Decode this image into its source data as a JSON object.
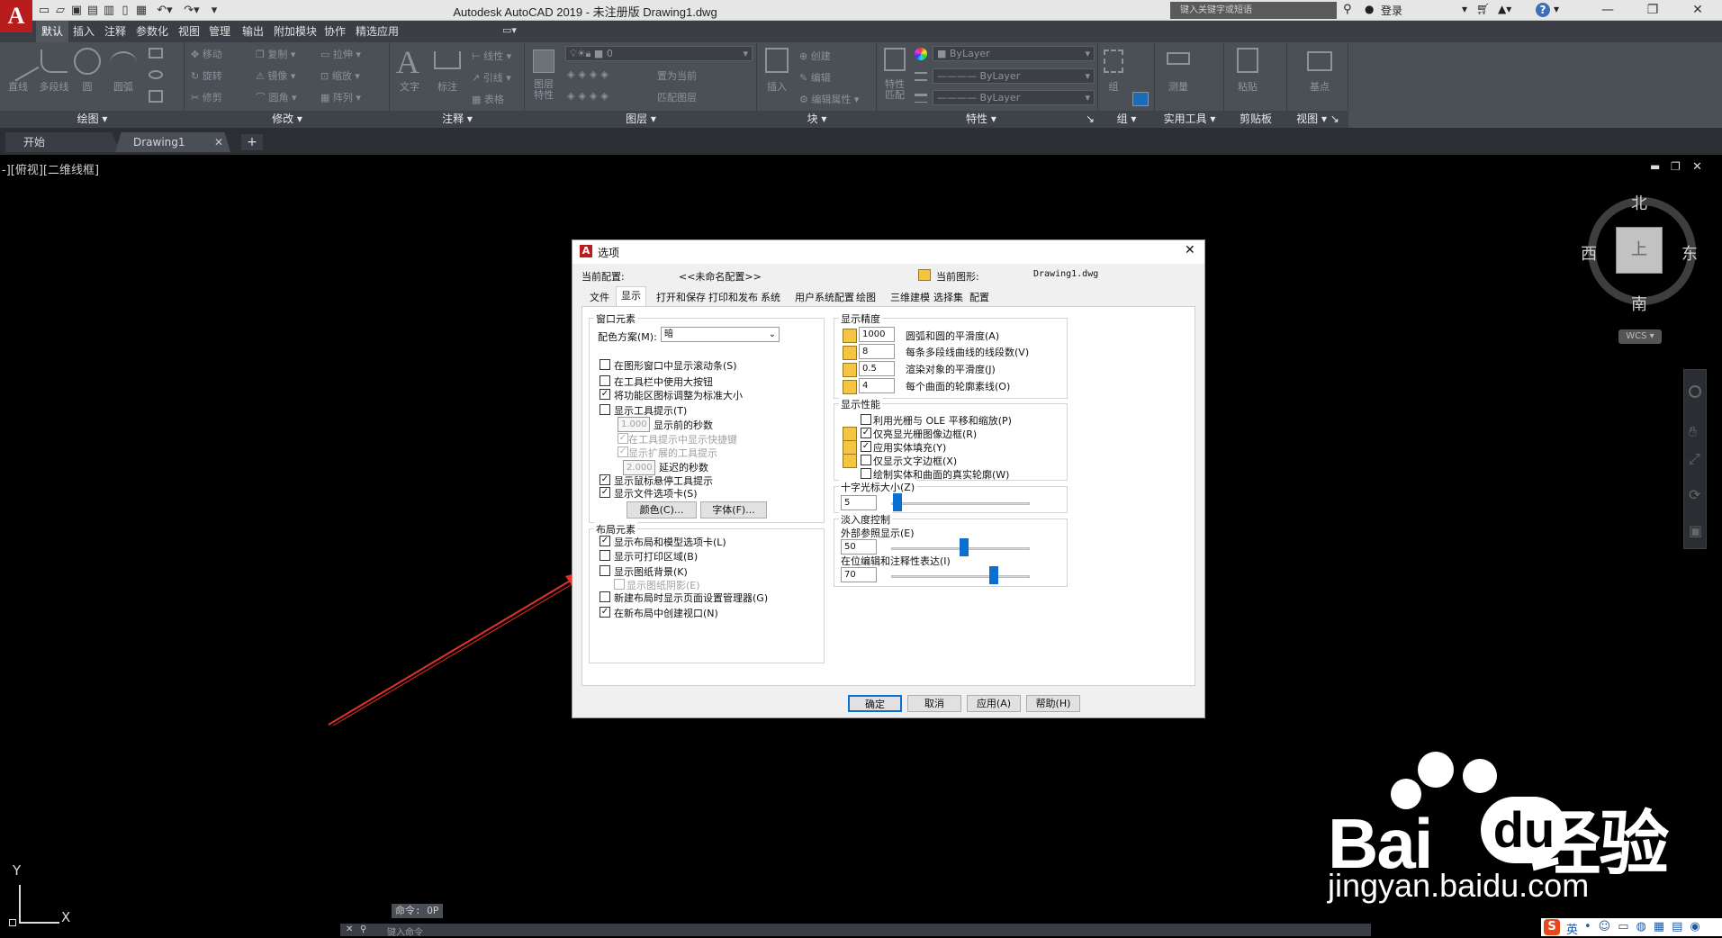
{
  "app": {
    "logo": "A",
    "title": "Autodesk AutoCAD 2019 - 未注册版    Drawing1.dwg",
    "search_placeholder": "键入关键字或短语",
    "login": "登录",
    "help": "?"
  },
  "ribbon_tabs": [
    "默认",
    "插入",
    "注释",
    "参数化",
    "视图",
    "管理",
    "输出",
    "附加模块",
    "协作",
    "精选应用"
  ],
  "ribbon": {
    "draw": {
      "label": "绘图",
      "tools": [
        "直线",
        "多段线",
        "圆",
        "圆弧"
      ]
    },
    "modify": {
      "label": "修改",
      "tools": [
        "移动",
        "旋转",
        "修剪",
        "复制",
        "镜像",
        "圆角",
        "拉伸",
        "缩放",
        "阵列"
      ]
    },
    "annotation": {
      "label": "注释",
      "tools": [
        "文字",
        "标注",
        "线性",
        "引线",
        "表格"
      ]
    },
    "layers": {
      "label": "图层",
      "tools": [
        "图层特性",
        "置为当前",
        "匹配图层"
      ],
      "current_layer": "0"
    },
    "block": {
      "label": "块",
      "tools": [
        "插入",
        "创建",
        "编辑",
        "编辑属性"
      ]
    },
    "properties": {
      "label": "特性",
      "tools": [
        "特性匹配"
      ],
      "color": "ByLayer",
      "linetype": "ByLayer",
      "lineweight": "ByLayer"
    },
    "groups": {
      "label": "组",
      "tools": [
        "组"
      ]
    },
    "utilities": {
      "label": "实用工具",
      "tools": [
        "测量"
      ]
    },
    "clipboard": {
      "label": "剪贴板",
      "tools": [
        "粘贴"
      ]
    },
    "view": {
      "label": "视图",
      "tools": [
        "基点"
      ]
    }
  },
  "file_tabs": [
    "开始",
    "Drawing1"
  ],
  "viewport_label": "-][俯视][二维线框]",
  "viewcube": {
    "north": "北",
    "south": "南",
    "east": "东",
    "west": "西",
    "top": "上",
    "wcs": "WCS"
  },
  "ucs": {
    "y": "Y",
    "x": "X"
  },
  "command": {
    "history": "命令: OP",
    "placeholder": "键入命令"
  },
  "dialog": {
    "title": "选项",
    "current_profile_label": "当前配置:",
    "current_profile": "<<未命名配置>>",
    "current_drawing_label": "当前图形:",
    "current_drawing": "Drawing1.dwg",
    "tabs": [
      "文件",
      "显示",
      "打开和保存",
      "打印和发布",
      "系统",
      "用户系统配置",
      "绘图",
      "三维建模",
      "选择集",
      "配置"
    ],
    "window_elements": {
      "title": "窗口元素",
      "color_scheme_label": "配色方案(M):",
      "color_scheme": "暗",
      "opt_scrollbars": "在图形窗口中显示滚动条(S)",
      "opt_large_buttons": "在工具栏中使用大按钮",
      "opt_resize_icons": "将功能区图标调整为标准大小",
      "opt_tooltips": "显示工具提示(T)",
      "seconds_before": "1.000",
      "seconds_before_label": "显示前的秒数",
      "opt_shortcut_keys": "在工具提示中显示快捷键",
      "opt_extended_tips": "显示扩展的工具提示",
      "delay_seconds": "2.000",
      "delay_seconds_label": "延迟的秒数",
      "opt_rollover": "显示鼠标悬停工具提示",
      "opt_file_tabs": "显示文件选项卡(S)",
      "colors_button": "颜色(C)...",
      "fonts_button": "字体(F)..."
    },
    "layout_elements": {
      "title": "布局元素",
      "opt_layout_tabs": "显示布局和模型选项卡(L)",
      "opt_printable_area": "显示可打印区域(B)",
      "opt_paper_bg": "显示图纸背景(K)",
      "opt_paper_shadow": "显示图纸阴影(E)",
      "opt_page_setup": "新建布局时显示页面设置管理器(G)",
      "opt_create_viewport": "在新布局中创建视口(N)"
    },
    "display_resolution": {
      "title": "显示精度",
      "arc_smooth": "1000",
      "arc_smooth_label": "圆弧和圆的平滑度(A)",
      "pline_segments": "8",
      "pline_segments_label": "每条多段线曲线的线段数(V)",
      "render_smooth": "0.5",
      "render_smooth_label": "渲染对象的平滑度(J)",
      "contour_lines": "4",
      "contour_lines_label": "每个曲面的轮廓素线(O)"
    },
    "display_performance": {
      "title": "显示性能",
      "opt_pan_zoom": "利用光栅与 OLE 平移和缩放(P)",
      "opt_highlight_raster": "仅亮显光栅图像边框(R)",
      "opt_solid_fill": "应用实体填充(Y)",
      "opt_text_frame": "仅显示文字边框(X)",
      "opt_silhouettes": "绘制实体和曲面的真实轮廓(W)"
    },
    "crosshair": {
      "title": "十字光标大小(Z)",
      "value": "5",
      "level": 5
    },
    "fade": {
      "title": "淡入度控制",
      "xref_label": "外部参照显示(E)",
      "xref_value": "50",
      "xref_level": 50,
      "inplace_label": "在位编辑和注释性表达(I)",
      "inplace_value": "70",
      "inplace_level": 70
    },
    "buttons": {
      "ok": "确定",
      "cancel": "取消",
      "apply": "应用(A)",
      "help": "帮助(H)"
    }
  },
  "watermark": {
    "brand": "Bai",
    "brand2": "du",
    "cn": "经验",
    "url": "jingyan.baidu.com"
  },
  "taskbar": {
    "ime": "英"
  },
  "colors": {
    "accent": "#0a6fd1",
    "arrow": "#e0302a",
    "logo": "#b91c1c"
  }
}
